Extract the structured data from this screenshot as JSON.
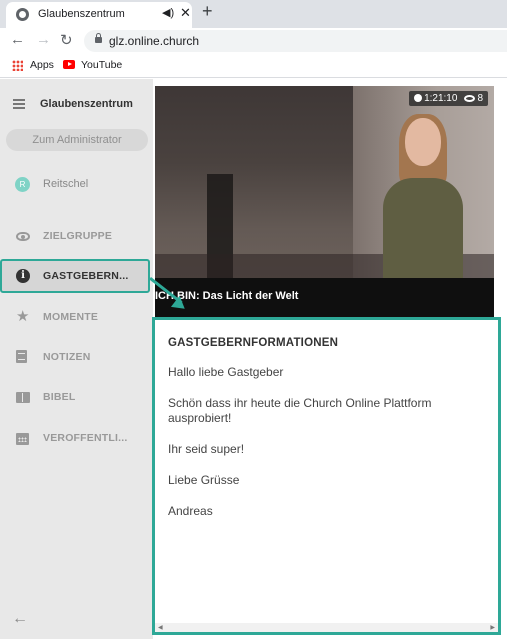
{
  "browser": {
    "tab_title": "Glaubenszentrum",
    "new_tab": "+",
    "url": "glz.online.church",
    "bookmarks": [
      {
        "label": "Apps",
        "icon": "apps-grid-icon"
      },
      {
        "label": "YouTube",
        "icon": "youtube-icon"
      }
    ]
  },
  "sidebar": {
    "church_name": "Glaubenszentrum",
    "admin_button": "Zum Administrator",
    "user": {
      "initial": "R",
      "name": "Reitschel"
    },
    "items": [
      {
        "label": "ZIELGRUPPE",
        "icon": "eye-icon"
      },
      {
        "label": "GASTGEBERN...",
        "icon": "info-icon",
        "active": true
      },
      {
        "label": "MOMENTE",
        "icon": "star-icon"
      },
      {
        "label": "NOTIZEN",
        "icon": "notes-icon"
      },
      {
        "label": "BIBEL",
        "icon": "bible-icon"
      },
      {
        "label": "VEROFFENTLI...",
        "icon": "calendar-icon"
      }
    ]
  },
  "video": {
    "duration": "1:21:10",
    "viewers": "8",
    "title": "ICH BIN: Das Licht der Welt"
  },
  "host_info": {
    "heading": "GASTGEBERNFORMATIONEN",
    "paragraphs": [
      "Hallo liebe Gastgeber",
      "Schön dass ihr heute die Church Online Plattform ausprobiert!",
      "Ihr seid super!",
      "Liebe Grüsse",
      "Andreas"
    ]
  },
  "colors": {
    "accent": "#2ea897",
    "sidebar_bg": "#e8e8e8",
    "active_item_bg": "#d6d6d6"
  }
}
